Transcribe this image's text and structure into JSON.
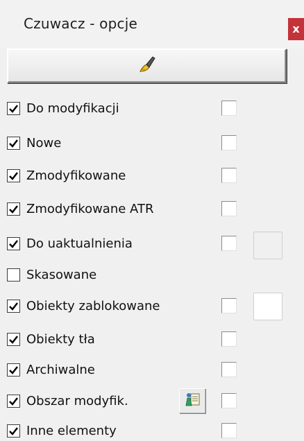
{
  "window": {
    "title": "Czuwacz - opcje",
    "close_label": "x"
  },
  "toolbar": {
    "brush_button_icon": "paintbrush-icon"
  },
  "options": [
    {
      "label": "Do modyfikacji",
      "checked": true,
      "right_checked": false
    },
    {
      "label": "Nowe",
      "checked": true,
      "right_checked": false
    },
    {
      "label": "Zmodyfikowane",
      "checked": true,
      "right_checked": false
    },
    {
      "label": "Zmodyfikowane ATR",
      "checked": true,
      "right_checked": false
    },
    {
      "label": "Do uaktualnienia",
      "checked": true,
      "right_checked": false
    },
    {
      "label": "Skasowane",
      "checked": false
    },
    {
      "label": "Obiekty zablokowane",
      "checked": true,
      "right_checked": false
    },
    {
      "label": "Obiekty tła",
      "checked": true,
      "right_checked": false
    },
    {
      "label": "Archiwalne",
      "checked": true,
      "right_checked": false
    },
    {
      "label": "Obszar modyfik.",
      "checked": true,
      "right_checked": false
    },
    {
      "label": "Inne elementy",
      "checked": true,
      "right_checked": false
    }
  ],
  "colors": {
    "close_button": "#c4323a",
    "swatch_do_uaktualnienia": "#f0f0f0",
    "swatch_obiekty_zablokowane": "#ffffff"
  },
  "icons": {
    "obszar_button_icon": "person-document-icon"
  }
}
